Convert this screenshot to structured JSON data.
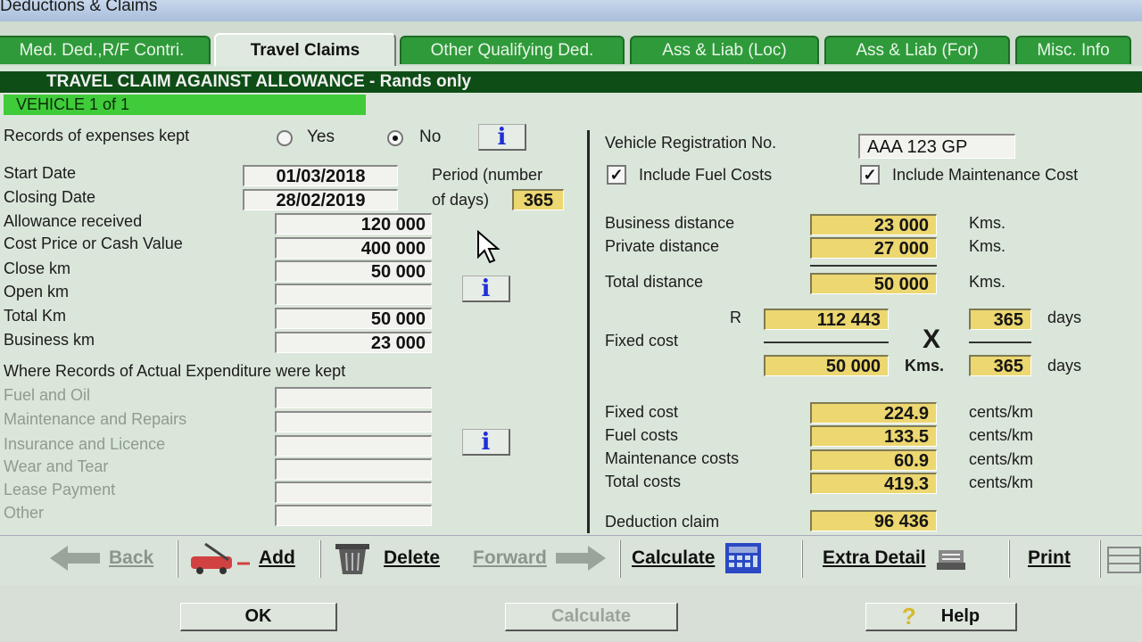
{
  "window": {
    "title": "Deductions & Claims"
  },
  "tabs": [
    {
      "label": "Med. Ded.,R/F Contri."
    },
    {
      "label": "Travel Claims"
    },
    {
      "label": "Other Qualifying Ded."
    },
    {
      "label": "Ass & Liab (Loc)"
    },
    {
      "label": "Ass & Liab (For)"
    },
    {
      "label": "Misc. Info"
    }
  ],
  "banner": "TRAVEL CLAIM AGAINST ALLOWANCE - Rands only",
  "vehicle": "VEHICLE 1 of 1",
  "records": {
    "label": "Records of expenses kept",
    "yes": "Yes",
    "no": "No",
    "selected": "No"
  },
  "left": {
    "start_date_label": "Start Date",
    "start_date": "01/03/2018",
    "closing_date_label": "Closing Date",
    "closing_date": "28/02/2019",
    "period_label_1": "Period (number",
    "period_label_2": "of days)",
    "period_days": "365",
    "allowance_label": "Allowance received",
    "allowance": "120 000",
    "cost_price_label": "Cost Price or Cash Value",
    "cost_price": "400 000",
    "close_km_label": "Close km",
    "close_km": "50 000",
    "open_km_label": "Open km",
    "open_km": "",
    "total_km_label": "Total  Km",
    "total_km": "50 000",
    "business_km_label": "Business km",
    "business_km": "23 000",
    "actual_heading": "Where Records of Actual Expenditure were kept",
    "fuel_oil_label": "Fuel and Oil",
    "fuel_oil": "",
    "maintenance_label": "Maintenance and Repairs",
    "maintenance": "",
    "insurance_label": "Insurance and Licence",
    "insurance": "",
    "wear_label": "Wear and Tear",
    "wear": "",
    "lease_label": "Lease Payment",
    "lease": "",
    "other_label": "Other",
    "other": ""
  },
  "right": {
    "reg_label": "Vehicle Registration No.",
    "reg_value": "AAA 123 GP",
    "include_fuel_label": "Include Fuel Costs",
    "include_fuel_checked": true,
    "include_maint_label": "Include Maintenance Cost",
    "include_maint_checked": true,
    "business_distance_label": "Business distance",
    "business_distance": "23 000",
    "private_distance_label": "Private distance",
    "private_distance": "27 000",
    "total_distance_label": "Total distance",
    "total_distance": "50 000",
    "kms_unit": "Kms.",
    "fixed_cost_label": "Fixed cost",
    "currency": "R",
    "fixed_rand": "112 443",
    "fixed_days_top": "365",
    "days_unit": "days",
    "times": "X",
    "fixed_kms": "50 000",
    "kms_bold": "Kms.",
    "fixed_days_bottom": "365",
    "fixed_cost_cpk_label": "Fixed cost",
    "fixed_cost_cpk": "224.9",
    "fuel_costs_label": "Fuel costs",
    "fuel_costs": "133.5",
    "maint_costs_label": "Maintenance costs",
    "maint_costs": "60.9",
    "total_costs_label": "Total costs",
    "total_costs": "419.3",
    "cpk_unit": "cents/km",
    "deduction_label": "Deduction claim",
    "deduction": "96 436"
  },
  "toolbar": {
    "back": "Back",
    "add": "Add",
    "delete": "Delete",
    "forward": "Forward",
    "calculate": "Calculate",
    "extra_detail": "Extra Detail",
    "print": "Print"
  },
  "footer": {
    "ok": "OK",
    "calculate": "Calculate",
    "help": "Help"
  }
}
